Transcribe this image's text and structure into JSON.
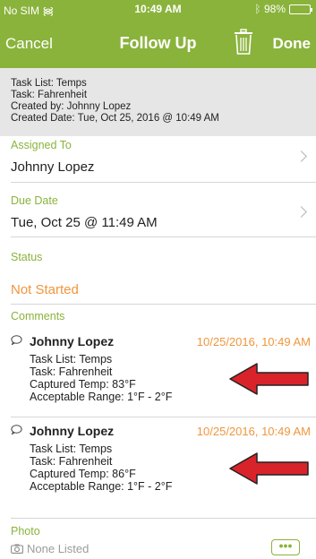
{
  "status_bar": {
    "carrier": "No SIM",
    "time": "10:49 AM",
    "battery": "98%",
    "battery_level": 0.98
  },
  "nav": {
    "cancel": "Cancel",
    "title": "Follow Up",
    "done": "Done"
  },
  "info": {
    "task_list": "Task List: Temps",
    "task": "Task: Fahrenheit",
    "created_by": "Created by: Johnny Lopez",
    "created_date": "Created Date: Tue, Oct 25, 2016 @ 10:49 AM"
  },
  "assigned_to": {
    "label": "Assigned To",
    "value": "Johnny Lopez"
  },
  "due_date": {
    "label": "Due Date",
    "value": "Tue, Oct 25 @ 11:49 AM"
  },
  "status": {
    "label": "Status",
    "value": "Not Started"
  },
  "comments": {
    "label": "Comments",
    "items": [
      {
        "author": "Johnny Lopez",
        "time": "10/25/2016, 10:49 AM",
        "lines": [
          "Task List: Temps",
          "Task: Fahrenheit",
          "Captured Temp: 83°F",
          "Acceptable Range: 1°F - 2°F"
        ]
      },
      {
        "author": "Johnny Lopez",
        "time": "10/25/2016, 10:49 AM",
        "lines": [
          "Task List: Temps",
          "Task: Fahrenheit",
          "Captured Temp: 86°F",
          "Acceptable Range: 1°F - 2°F"
        ]
      }
    ]
  },
  "photo": {
    "label": "Photo",
    "none": "None Listed",
    "more": "•••"
  },
  "colors": {
    "brand_green": "#8ab33c",
    "accent_orange": "#f0963c",
    "arrow_red": "#d9232a"
  }
}
